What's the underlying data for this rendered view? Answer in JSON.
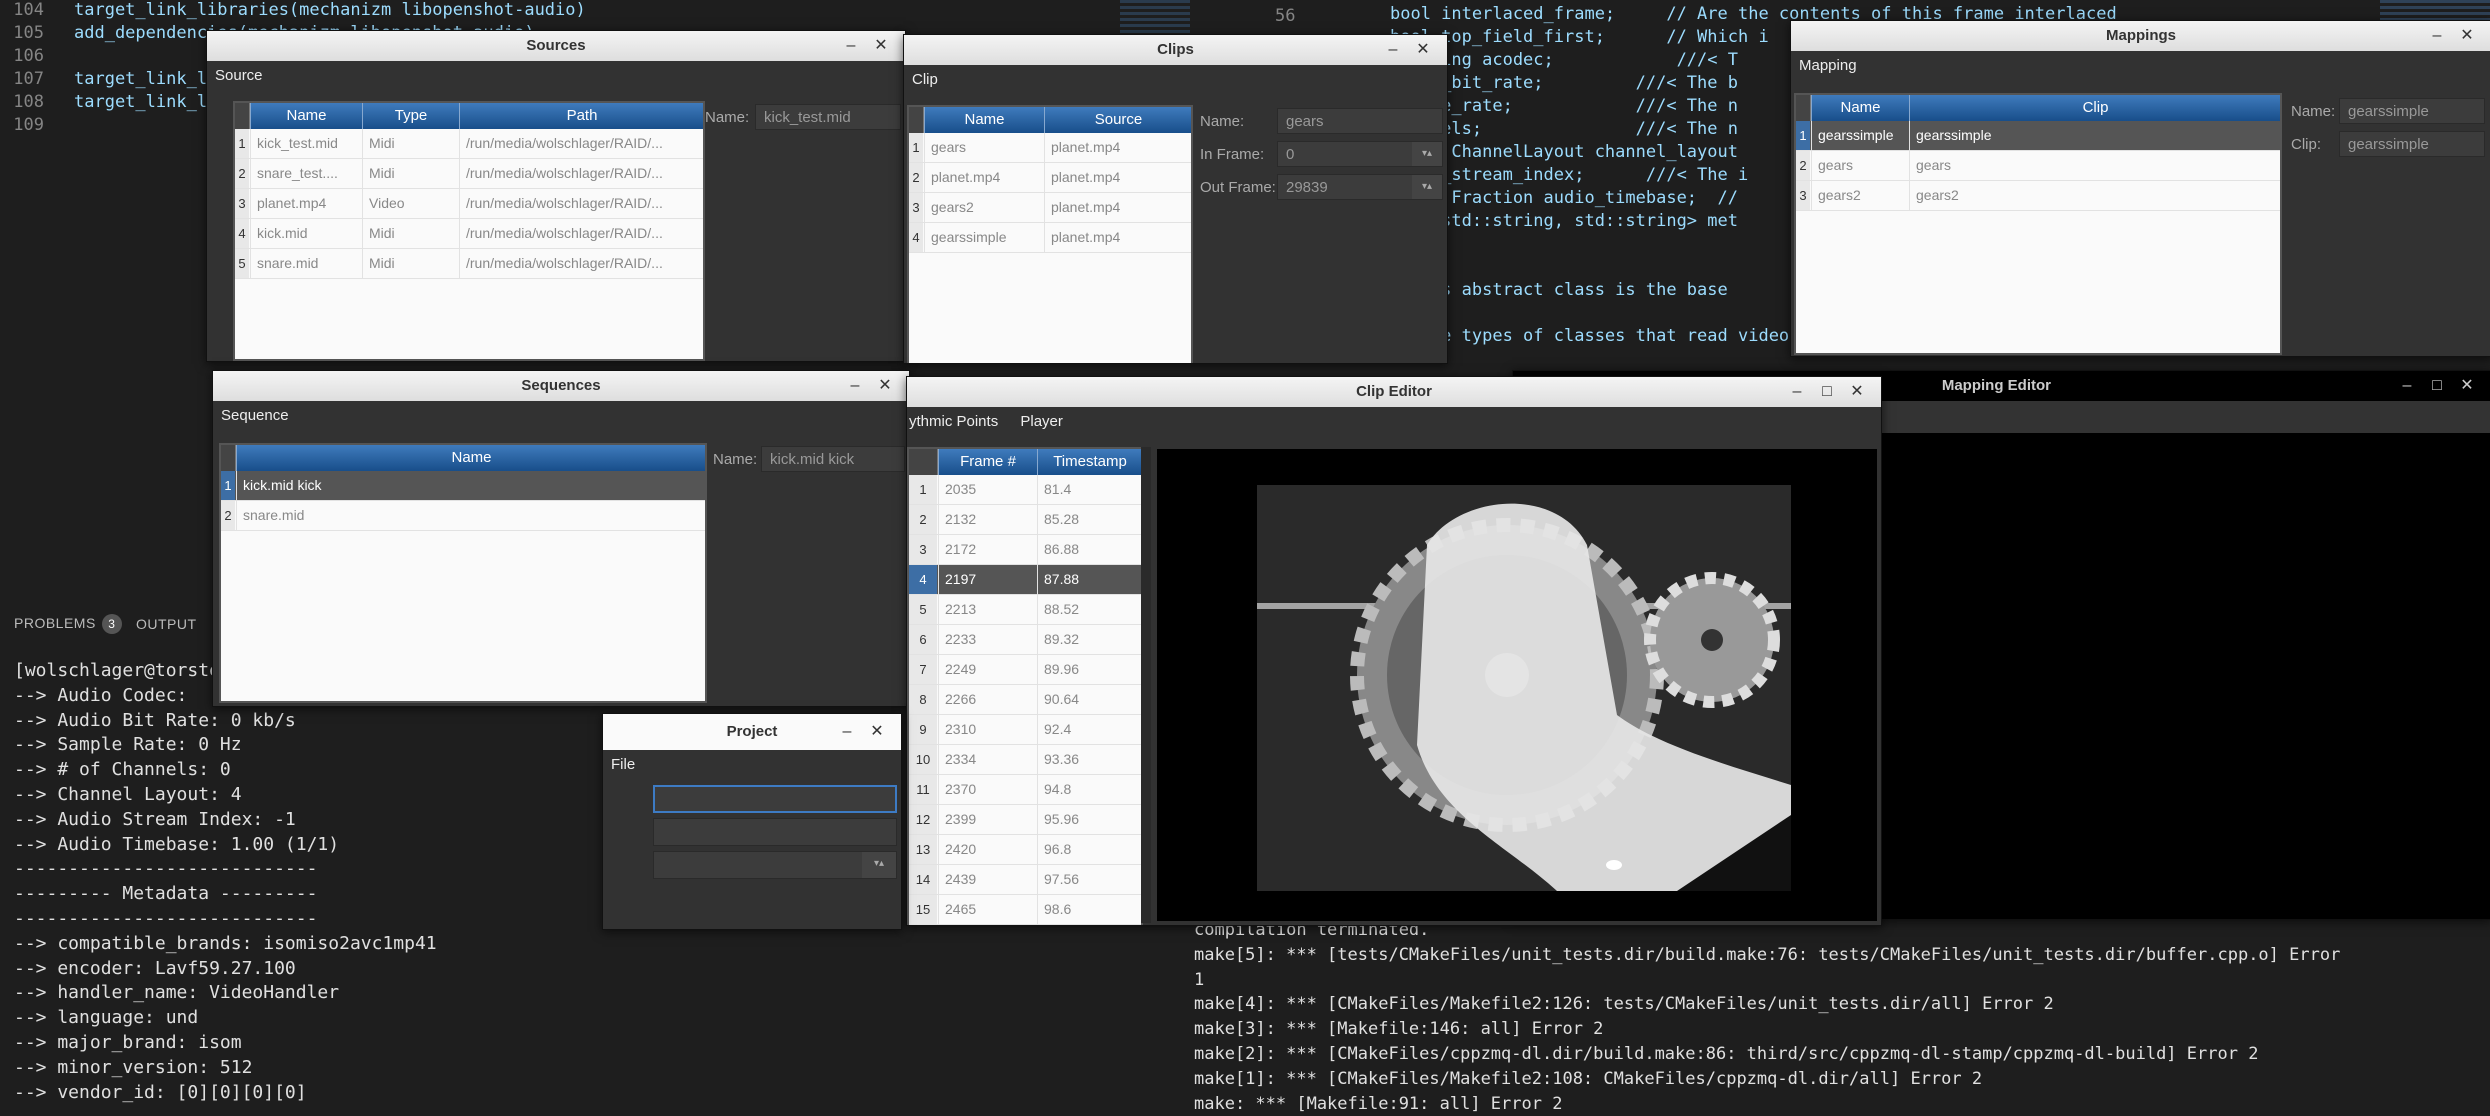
{
  "editor": {
    "lines": [
      {
        "num": "104",
        "text": "target_link_libraries(mechanizm libopenshot-audio)"
      },
      {
        "num": "105",
        "text": "add_dependencies(mechanizm libopenshot-audio)"
      },
      {
        "num": "106",
        "text": ""
      },
      {
        "num": "107",
        "text": "target_link_l"
      },
      {
        "num": "108",
        "text": "target_link_l"
      },
      {
        "num": "109",
        "text": ""
      }
    ],
    "gutter_right": "56",
    "right_code": [
      "bool interlaced_frame;     // Are the contents of this frame interlaced",
      "bool top_field_first;      // Which i",
      "::string acodec;            ///< T",
      "audio_bit_rate;         ///< The b",
      "sample_rate;            ///< The n",
      "channels;               ///< The n",
      "shot::ChannelLayout channel_layout",
      "audio_stream_index;      ///< The i",
      "shot::Fraction audio_timebase;  //",
      ":map<std::string, std::string> met",
      "",
      "",
      "f This abstract class is the base",
      "",
      "rs are types of classes that read video, audio, and image files, and"
    ]
  },
  "bottom_panel": {
    "problems_label": "PROBLEMS",
    "problems_count": "3",
    "output_label": "OUTPUT"
  },
  "terminal": [
    "[wolschlager@torsten",
    "--> Audio Codec:",
    "--> Audio Bit Rate: 0 kb/s",
    "--> Sample Rate: 0 Hz",
    "--> # of Channels: 0",
    "--> Channel Layout: 4",
    "--> Audio Stream Index: -1",
    "--> Audio Timebase: 1.00 (1/1)",
    "----------------------------",
    "--------- Metadata ---------",
    "----------------------------",
    "--> compatible_brands: isomiso2avc1mp41",
    "--> encoder: Lavf59.27.100",
    "--> handler_name: VideoHandler",
    "--> language: und",
    "--> major_brand: isom",
    "--> minor_version: 512",
    "--> vendor_id: [0][0][0][0]"
  ],
  "build_output": [
    "compilation terminated.",
    "make[5]: *** [tests/CMakeFiles/unit_tests.dir/build.make:76: tests/CMakeFiles/unit_tests.dir/buffer.cpp.o] Error",
    "1",
    "make[4]: *** [CMakeFiles/Makefile2:126: tests/CMakeFiles/unit_tests.dir/all] Error 2",
    "make[3]: *** [Makefile:146: all] Error 2",
    "make[2]: *** [CMakeFiles/cppzmq-dl.dir/build.make:86: third/src/cppzmq-dl-stamp/cppzmq-dl-build] Error 2",
    "make[1]: *** [CMakeFiles/Makefile2:108: CMakeFiles/cppzmq-dl.dir/all] Error 2",
    "make: *** [Makefile:91: all] Error 2"
  ],
  "sources": {
    "title": "Sources",
    "menu": [
      "Source"
    ],
    "columns": [
      "Name",
      "Type",
      "Path"
    ],
    "rows": [
      [
        "1",
        "kick_test.mid",
        "Midi",
        "/run/media/wolschlager/RAID/..."
      ],
      [
        "2",
        "snare_test....",
        "Midi",
        "/run/media/wolschlager/RAID/..."
      ],
      [
        "3",
        "planet.mp4",
        "Video",
        "/run/media/wolschlager/RAID/..."
      ],
      [
        "4",
        "kick.mid",
        "Midi",
        "/run/media/wolschlager/RAID/..."
      ],
      [
        "5",
        "snare.mid",
        "Midi",
        "/run/media/wolschlager/RAID/..."
      ]
    ],
    "name_label": "Name:",
    "name_value": "kick_test.mid"
  },
  "clips": {
    "title": "Clips",
    "menu": [
      "Clip"
    ],
    "columns": [
      "Name",
      "Source"
    ],
    "rows": [
      [
        "1",
        "gears",
        "planet.mp4"
      ],
      [
        "2",
        "planet.mp4",
        "planet.mp4"
      ],
      [
        "3",
        "gears2",
        "planet.mp4"
      ],
      [
        "4",
        "gearssimple",
        "planet.mp4"
      ]
    ],
    "name_label": "Name:",
    "name_value": "gears",
    "in_label": "In Frame:",
    "in_value": "0",
    "out_label": "Out Frame:",
    "out_value": "29839"
  },
  "mappings": {
    "title": "Mappings",
    "menu": [
      "Mapping"
    ],
    "columns": [
      "Name",
      "Clip"
    ],
    "rows": [
      [
        "1",
        "gearssimple",
        "gearssimple"
      ],
      [
        "2",
        "gears",
        "gears"
      ],
      [
        "3",
        "gears2",
        "gears2"
      ]
    ],
    "name_label": "Name:",
    "name_value": "gearssimple",
    "clip_label": "Clip:",
    "clip_value": "gearssimple"
  },
  "sequences": {
    "title": "Sequences",
    "menu": [
      "Sequence"
    ],
    "columns": [
      "Name"
    ],
    "rows": [
      [
        "1",
        "kick.mid kick"
      ],
      [
        "2",
        "snare.mid"
      ]
    ],
    "name_label": "Name:",
    "name_value": "kick.mid kick"
  },
  "clip_editor": {
    "title": "Clip Editor",
    "menu": [
      "ythmic Points",
      "Player"
    ],
    "columns": [
      "Frame #",
      "Timestamp"
    ],
    "rows": [
      [
        "1",
        "2035",
        "81.4"
      ],
      [
        "2",
        "2132",
        "85.28"
      ],
      [
        "3",
        "2172",
        "86.88"
      ],
      [
        "4",
        "2197",
        "87.88"
      ],
      [
        "5",
        "2213",
        "88.52"
      ],
      [
        "6",
        "2233",
        "89.32"
      ],
      [
        "7",
        "2249",
        "89.96"
      ],
      [
        "8",
        "2266",
        "90.64"
      ],
      [
        "9",
        "2310",
        "92.4"
      ],
      [
        "10",
        "2334",
        "93.36"
      ],
      [
        "11",
        "2370",
        "94.8"
      ],
      [
        "12",
        "2399",
        "95.96"
      ],
      [
        "13",
        "2420",
        "96.8"
      ],
      [
        "14",
        "2439",
        "97.56"
      ],
      [
        "15",
        "2465",
        "98.6"
      ]
    ],
    "selected_row": 4
  },
  "mapping_editor": {
    "title": "Mapping Editor"
  },
  "project": {
    "title": "Project",
    "menu": [
      "File"
    ],
    "name_value": "",
    "path_value": "",
    "row3_value": ""
  }
}
